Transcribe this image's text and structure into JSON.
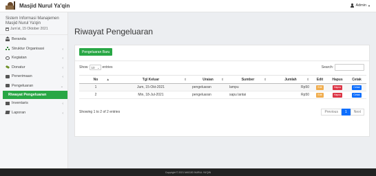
{
  "header": {
    "brand": "Masjid Nurul Ya'qin",
    "user": "Admin"
  },
  "sidebar": {
    "system_title": "Sistem Informasi Manajemen Masjid Nurul Ya'qin",
    "date": "Jum'at, 15 Oktober 2021",
    "items": [
      {
        "label": "Beranda",
        "icon": "home-icon",
        "has_children": false
      },
      {
        "label": "Struktur Organisasi",
        "icon": "sitemap-icon",
        "has_children": true
      },
      {
        "label": "Kegiatan",
        "icon": "clock-icon",
        "has_children": true
      },
      {
        "label": "Donatur",
        "icon": "users-icon",
        "has_children": true
      },
      {
        "label": "Penerimaan",
        "icon": "folder-icon",
        "has_children": true
      },
      {
        "label": "Pengeluaran",
        "icon": "folder-icon",
        "has_children": true
      },
      {
        "label": "Riwayat Pengeluaran",
        "icon": "",
        "has_children": false
      },
      {
        "label": "Inventaris",
        "icon": "table-icon",
        "has_children": true
      },
      {
        "label": "Laporan",
        "icon": "book-icon",
        "has_children": true
      }
    ]
  },
  "main": {
    "title": "Riwayat Pengeluaran",
    "add_button": "Pengeluaran Baru",
    "show_label": "Show",
    "entries_value": "10",
    "entries_label": "entries",
    "search_label": "Search:",
    "search_value": "",
    "columns": [
      "No",
      "Tgl Keluar",
      "Uraian",
      "Sumber",
      "Jumlah",
      "Edit",
      "Hapus",
      "Cetak"
    ],
    "rows": [
      {
        "no": "1",
        "tgl": "Jum, 15-Okt-2021",
        "uraian": "pengeluaran",
        "sumber": "lampu",
        "jumlah": "Rp50",
        "edit": "Edit",
        "hapus": "Hapus",
        "cetak": "Cetak"
      },
      {
        "no": "2",
        "tgl": "Min, 18-Jul-2021",
        "uraian": "pengeluaran",
        "sumber": "sapu lantai",
        "jumlah": "Rp50",
        "edit": "Edit",
        "hapus": "Hapus",
        "cetak": "Cetak"
      }
    ],
    "info": "Showing 1 to 2 of 2 entries",
    "pager": {
      "prev": "Previous",
      "current": "1",
      "next": "Next"
    }
  },
  "footer": "Copyright © 2021 MASJID NURUL YA'QIN",
  "colors": {
    "primary_green": "#28a745",
    "edit": "#f0ad4e",
    "hapus": "#dc3545",
    "cetak": "#0d6efd",
    "footer_bg": "#222222"
  }
}
